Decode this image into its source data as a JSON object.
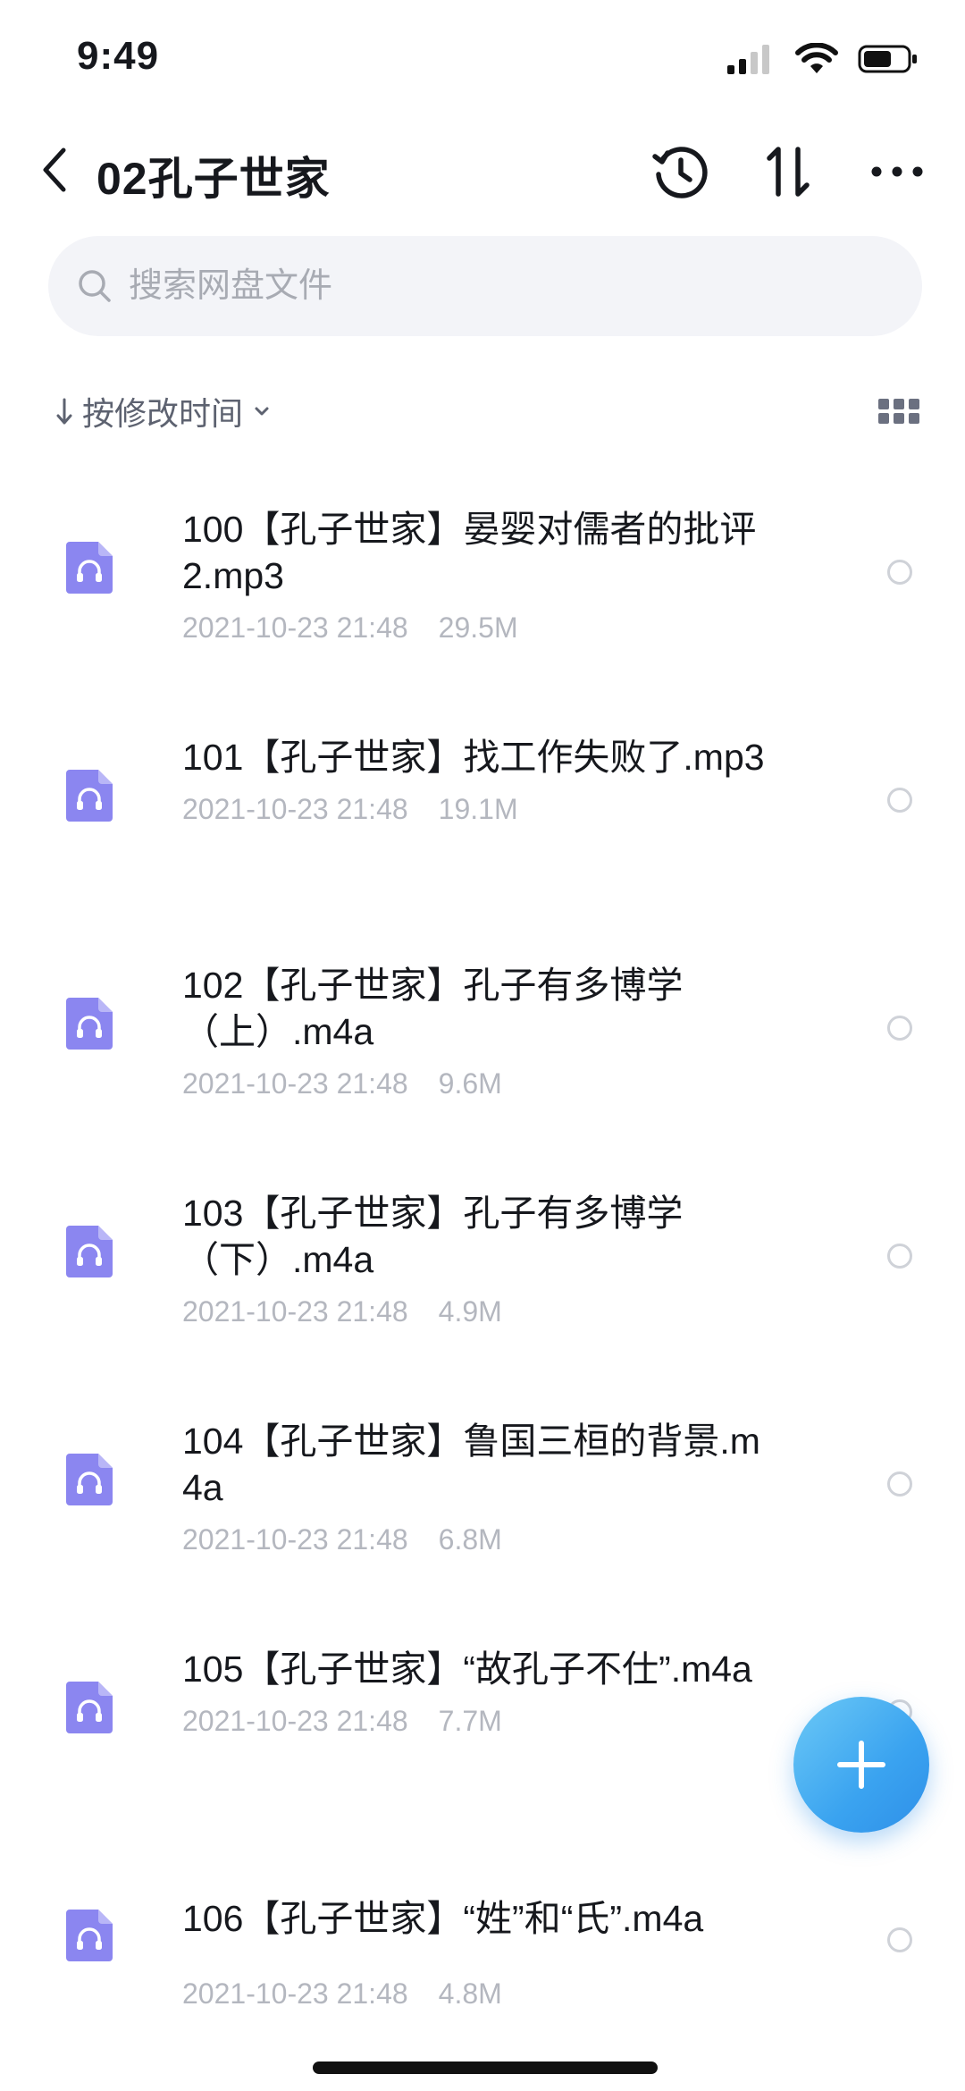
{
  "status_bar": {
    "time": "9:49"
  },
  "header": {
    "title": "02孔子世家"
  },
  "search": {
    "placeholder": "搜索网盘文件"
  },
  "sort": {
    "label": "按修改时间"
  },
  "files": [
    {
      "name": "100【孔子世家】晏婴对儒者的批评2.mp3",
      "date": "2021-10-23 21:48",
      "size": "29.5M"
    },
    {
      "name": "101【孔子世家】找工作失败了.mp3",
      "date": "2021-10-23 21:48",
      "size": "19.1M"
    },
    {
      "name": "102【孔子世家】孔子有多博学（上）.m4a",
      "date": "2021-10-23 21:48",
      "size": "9.6M"
    },
    {
      "name": "103【孔子世家】孔子有多博学（下）.m4a",
      "date": "2021-10-23 21:48",
      "size": "4.9M"
    },
    {
      "name": "104【孔子世家】鲁国三桓的背景.m4a",
      "date": "2021-10-23 21:48",
      "size": "6.8M"
    },
    {
      "name": "105【孔子世家】“故孔子不仕”.m4a",
      "date": "2021-10-23 21:48",
      "size": "7.7M"
    },
    {
      "name": "106【孔子世家】“姓”和“氏”.m4a",
      "date": "2021-10-23 21:48",
      "size": "4.8M"
    }
  ],
  "colors": {
    "accent": "#3aa3f0",
    "file_icon": "#8b86f0",
    "meta_text": "#b4b7bf"
  },
  "icons": {
    "back": "chevron-left-icon",
    "history": "history-icon",
    "sort": "sort-arrows-icon",
    "more": "more-icon",
    "search": "search-icon",
    "grid": "grid-icon",
    "audio": "audio-file-icon",
    "add": "plus-icon"
  }
}
